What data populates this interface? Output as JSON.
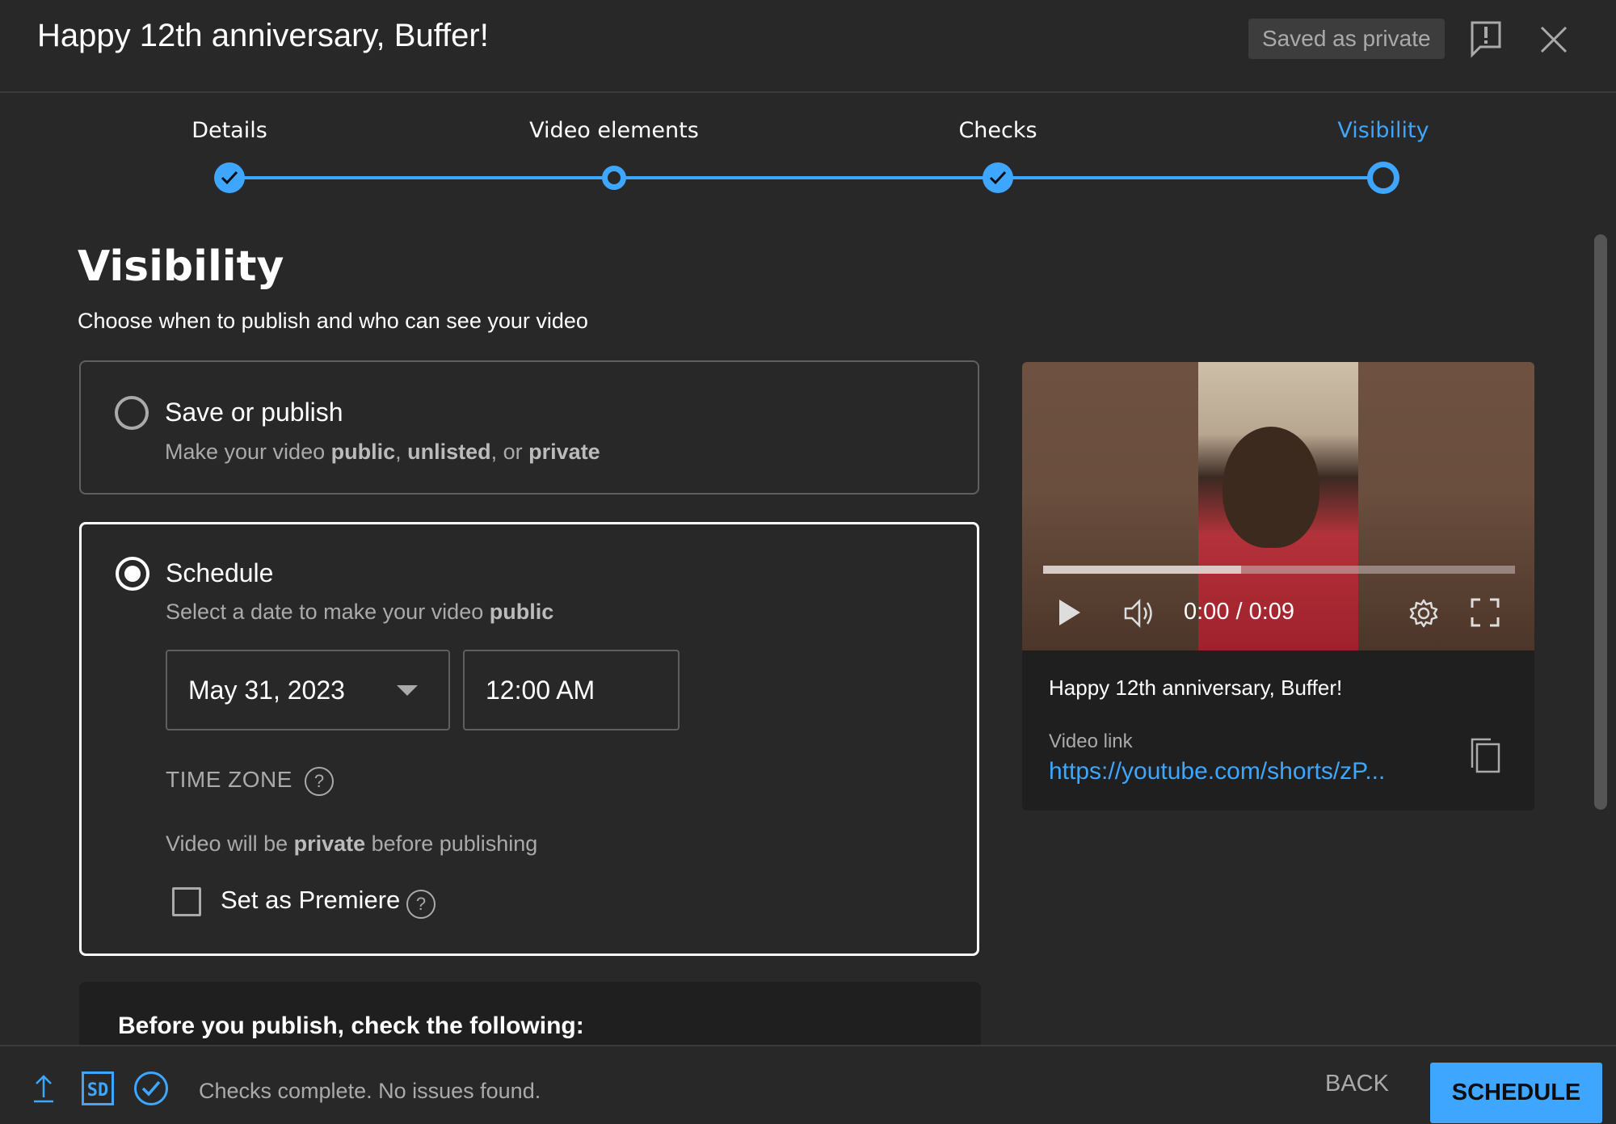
{
  "header": {
    "title": "Happy 12th anniversary, Buffer!",
    "saved_badge": "Saved as private",
    "feedback_icon": "feedback-flag-icon",
    "close_icon": "close-icon"
  },
  "stepper": {
    "steps": [
      {
        "label": "Details",
        "state": "done"
      },
      {
        "label": "Video elements",
        "state": "incomplete"
      },
      {
        "label": "Checks",
        "state": "done"
      },
      {
        "label": "Visibility",
        "state": "active"
      }
    ]
  },
  "content": {
    "title": "Visibility",
    "subtitle": "Choose when to publish and who can see your video"
  },
  "save_or_publish": {
    "title": "Save or publish",
    "desc_prefix": "Make your video ",
    "desc_public": "public",
    "desc_sep1": ", ",
    "desc_unlisted": "unlisted",
    "desc_sep2": ", or ",
    "desc_private": "private",
    "selected": false
  },
  "schedule": {
    "title": "Schedule",
    "desc_prefix": "Select a date to make your video ",
    "desc_bold": "public",
    "selected": true,
    "date_value": "May 31, 2023",
    "time_value": "12:00 AM",
    "timezone_label": "TIME ZONE",
    "help_glyph": "?",
    "private_prefix": "Video will be ",
    "private_bold": "private",
    "private_suffix": " before publishing",
    "premiere_label": "Set as Premiere",
    "premiere_checked": false
  },
  "before_publish": {
    "title": "Before you publish, check the following:"
  },
  "preview": {
    "time_readout": "0:00 / 0:09",
    "buffered_fraction": 0.42,
    "played_fraction": 0,
    "video_title": "Happy 12th anniversary, Buffer!",
    "link_label": "Video link",
    "link_value": "https://youtube.com/shorts/zP..."
  },
  "footer": {
    "status": "Checks complete. No issues found.",
    "sd_badge": "SD",
    "back_label": "BACK",
    "schedule_label": "SCHEDULE"
  },
  "colors": {
    "accent": "#3ea6ff",
    "background": "#282828",
    "panel": "#1f1f1f"
  }
}
